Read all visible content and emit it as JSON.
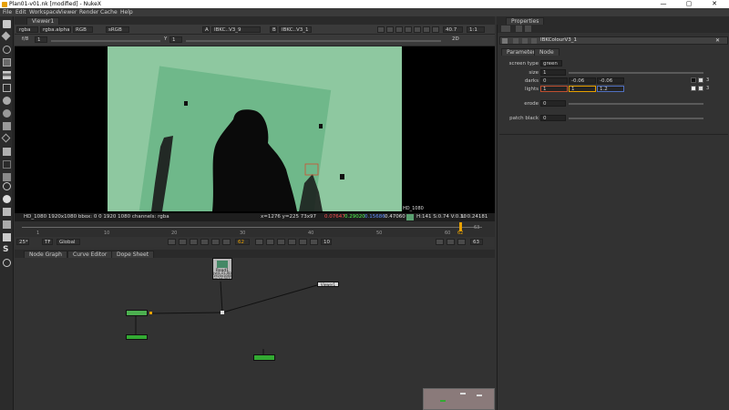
{
  "window": {
    "title": "Plan01-v01.nk [modified] - NukeX",
    "minimize": "—",
    "maximize": "▢",
    "close": "✕"
  },
  "menu": [
    "File",
    "Edit",
    "Workspace",
    "Viewer",
    "Render",
    "Cache",
    "Help"
  ],
  "viewer": {
    "tab": "Viewer1",
    "channels": "rgba",
    "layer": "rgba.alpha",
    "colorspace": "RGB",
    "lut": "sRGB",
    "input_a_label": "A",
    "input_a": "IBKC..V3_9",
    "input_b_label": "B",
    "input_b": "IBKC..V3_1",
    "gain_label": "f/8",
    "gain_value": "1",
    "gamma_label": "Y",
    "gamma_value": "1",
    "zoom": "40.7",
    "proxy": "1:1",
    "mode": "2D",
    "format_label": "HD_1080"
  },
  "status": {
    "info": "HD_1080 1920x1080  bbox: 0 0 1920 1080 channels: rgba",
    "coords": "x=1276 y=225 73x97",
    "r": "0.07647",
    "g": "0.29020",
    "b": "0.15686",
    "a": "0.47060",
    "hsv": "H:141 S:0.74 V:0.30",
    "lum": "L: 0.24181"
  },
  "timeline": {
    "ticks": [
      "1",
      "10",
      "20",
      "30",
      "40",
      "50",
      "60",
      "62"
    ],
    "current_frame": "62",
    "end_frame": "63"
  },
  "playback": {
    "fps_label": "25*",
    "tc_label": "TF",
    "global": "Global",
    "frame": "62",
    "increment": "10",
    "end": "63"
  },
  "graph_tabs": [
    "Node Graph",
    "Curve Editor",
    "Dope Sheet"
  ],
  "nodes": {
    "read": "Read1",
    "read_sub": "(v01-01-RD\n1920x1080\nno lut-001)",
    "viewer": "Viewer1"
  },
  "properties": {
    "tab": "Properties",
    "node_name": "IBKColourV3_1",
    "subtabs": [
      "Parameters",
      "Node"
    ],
    "screen_type_label": "screen type",
    "screen_type": "green",
    "size_label": "size",
    "size": "1",
    "darks_label": "darks",
    "darks": [
      "0",
      "-0.06",
      "-0.06"
    ],
    "lights_label": "lights",
    "lights": [
      "1",
      "1",
      "1.2"
    ],
    "count_a": "3",
    "count_b": "3",
    "erode_label": "erode",
    "erode": "0",
    "patch_black_label": "patch black",
    "patch_black": "0"
  },
  "colors": {
    "key_green": "#8ec8a0",
    "accent_orange": "#e8a000",
    "node_green": "#33aa33"
  }
}
